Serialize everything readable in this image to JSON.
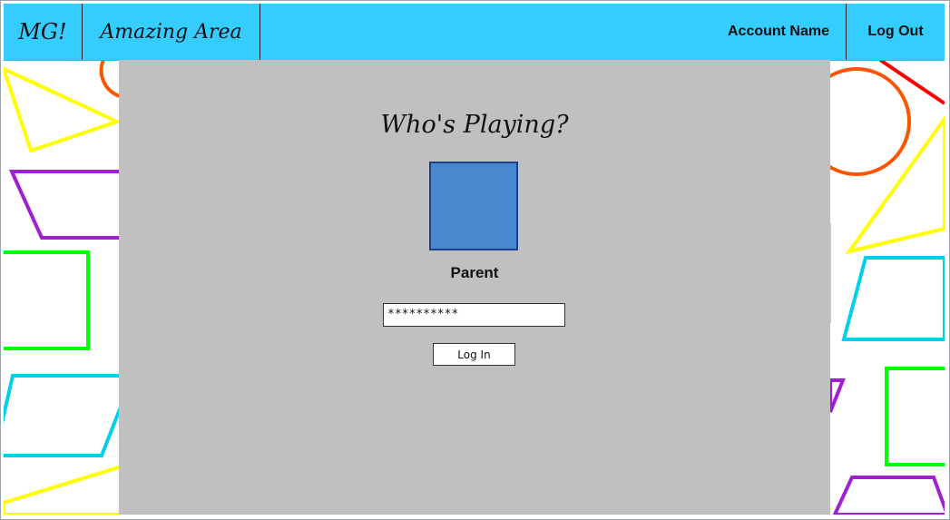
{
  "topbar": {
    "logo": "MG!",
    "area_title": "Amazing Area",
    "account_name": "Account Name",
    "logout_label": "Log Out",
    "color": "#35cdff"
  },
  "main": {
    "heading": "Who's Playing?",
    "profile": {
      "name": "Parent",
      "avatar_color": "#4788cf"
    },
    "password": {
      "value": "**********"
    },
    "login_label": "Log In",
    "panel_color": "#c0c0c0"
  },
  "decor": {
    "shape_colors": [
      "#ffff00",
      "#a020d0",
      "#00ff00",
      "#00d0e8",
      "#ff5500",
      "#ff0000"
    ]
  }
}
